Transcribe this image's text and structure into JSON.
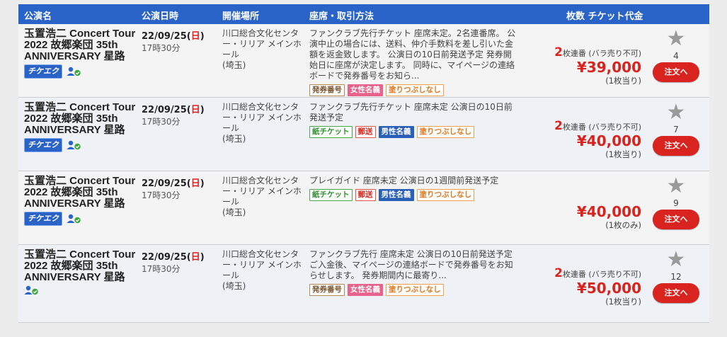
{
  "header": {
    "col_name": "公演名",
    "col_date": "公演日時",
    "col_venue": "開催場所",
    "col_seat": "座席・取引方法",
    "col_price": "枚数 チケット代金"
  },
  "rows": [
    {
      "title": "玉置浩二 Concert Tour 2022 故郷楽団 35th ANNIVERSARY 星路",
      "date": "22/09/25(",
      "dow": "日",
      "date_close": ")",
      "time": "17時30分",
      "venue": "川口総合文化センター・リリア メインホール",
      "pref": "(埼玉)",
      "seat": "ファンクラブ先行チケット 座席未定。2名連番席。 公演中止の場合には、送料、仲介手数料を差し引いた金額を返金致します。 公演日の10日前発送予定 発券開始日に座席が決定します。 同時に、マイページの連絡ボードで発券番号をお知ら...",
      "tags": [
        "発券番号",
        "女性名義",
        "塗りつぶしなし"
      ],
      "ticketeku": "チケエク",
      "qty_num": "2",
      "qty_text": "枚連番 (バラ売り不可)",
      "price": "¥39,000",
      "per": "(1枚当り)",
      "fav_count": "4",
      "order": "注文へ"
    },
    {
      "title": "玉置浩二 Concert Tour 2022 故郷楽団 35th ANNIVERSARY 星路",
      "date": "22/09/25(",
      "dow": "日",
      "date_close": ")",
      "time": "17時30分",
      "venue": "川口総合文化センター・リリア メインホール",
      "pref": "(埼玉)",
      "seat": "ファンクラブ先行チケット 座席未定 公演日の10日前発送予定",
      "tags": [
        "紙チケット",
        "郵送",
        "男性名義",
        "塗りつぶしなし"
      ],
      "ticketeku": "チケエク",
      "qty_num": "2",
      "qty_text": "枚連番 (バラ売り不可)",
      "price": "¥40,000",
      "per": "(1枚当り)",
      "fav_count": "7",
      "order": "注文へ"
    },
    {
      "title": "玉置浩二 Concert Tour 2022 故郷楽団 35th ANNIVERSARY 星路",
      "date": "22/09/25(",
      "dow": "日",
      "date_close": ")",
      "time": "17時30分",
      "venue": "川口総合文化センター・リリア メインホール",
      "pref": "(埼玉)",
      "seat": "プレイガイド 座席未定 公演日の1週間前発送予定",
      "tags": [
        "紙チケット",
        "郵送",
        "男性名義",
        "塗りつぶしなし"
      ],
      "ticketeku": "チケエク",
      "qty_num": "",
      "qty_text": "",
      "price": "¥40,000",
      "per": "(1枚のみ)",
      "fav_count": "9",
      "order": "注文へ"
    },
    {
      "title": "玉置浩二 Concert Tour 2022 故郷楽団 35th ANNIVERSARY 星路",
      "date": "22/09/25(",
      "dow": "日",
      "date_close": ")",
      "time": "17時30分",
      "venue": "川口総合文化センター・リリア メインホール",
      "pref": "(埼玉)",
      "seat": "ファンクラブ先行 座席未定 公演日の10日前発送予定 ご入金後、マイページの連絡ボードで発券番号をお知らせします。 発券期間内に最寄り...",
      "tags": [
        "発券番号",
        "女性名義",
        "塗りつぶしなし"
      ],
      "ticketeku": "",
      "qty_num": "2",
      "qty_text": "枚連番 (バラ売り不可)",
      "price": "¥50,000",
      "per": "(1枚当り)",
      "fav_count": "12",
      "order": "注文へ"
    }
  ],
  "tag_colors": {
    "発券番号": "brown",
    "女性名義": "pink",
    "塗りつぶしなし": "orange",
    "紙チケット": "green",
    "郵送": "red",
    "男性名義": "blue"
  },
  "colors": {
    "header_bg": "#2a63c8",
    "price_red": "#d9231e",
    "order_button": "#d9231e"
  }
}
